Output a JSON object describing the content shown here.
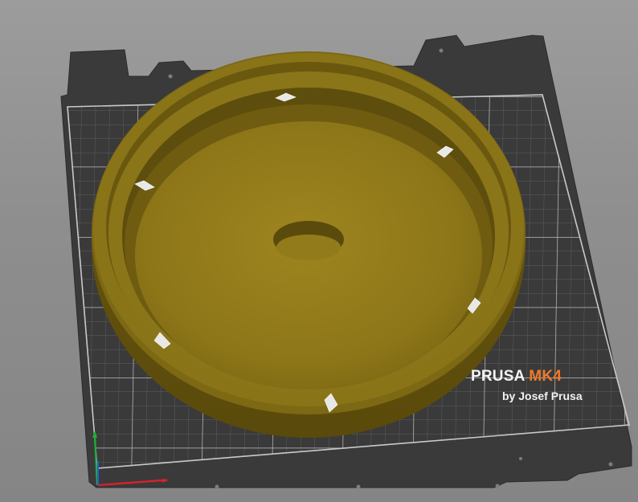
{
  "bed": {
    "brand": "PRUSA",
    "model": "MK4",
    "byline": "by Josef Prusa"
  },
  "model": {
    "color": "#7a6512"
  },
  "axes": {
    "x_color": "#e0202a",
    "y_color": "#1fae3a",
    "z_color": "#2a58d8"
  }
}
